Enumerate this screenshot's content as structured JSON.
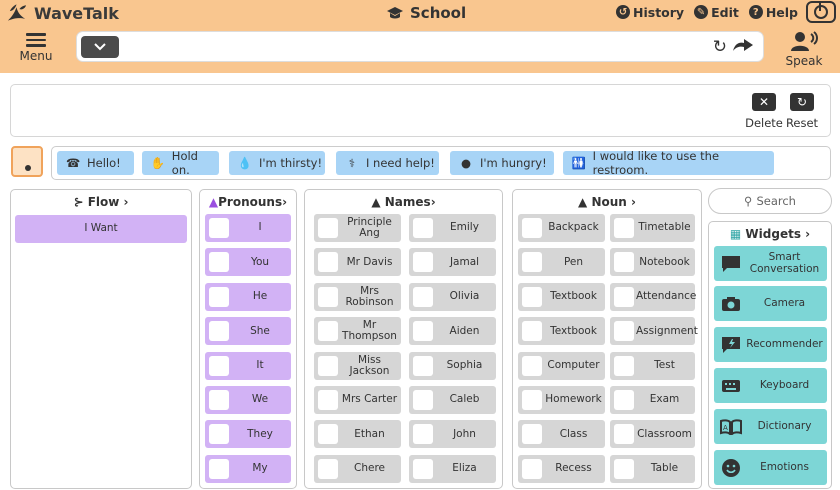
{
  "app": {
    "name": "WaveTalk",
    "title": "School"
  },
  "toplinks": [
    {
      "label": "History",
      "icon": "history-icon"
    },
    {
      "label": "Edit",
      "icon": "edit-icon"
    },
    {
      "label": "Help",
      "icon": "help-icon"
    }
  ],
  "toolbar": {
    "menu_label": "Menu",
    "speak_label": "Speak",
    "input_value": ""
  },
  "message": {
    "delete_label": "Delete",
    "reset_label": "Reset",
    "text": ""
  },
  "phrases": [
    "Hello!",
    "Hold on.",
    "I'm thirsty!",
    "I need help!",
    "I'm hungry!",
    "I would like to use the restroom."
  ],
  "flow": {
    "header": "Flow",
    "items": [
      "I Want"
    ]
  },
  "pronouns": {
    "header": "Pronouns",
    "items": [
      "I",
      "You",
      "He",
      "She",
      "It",
      "We",
      "They",
      "My"
    ]
  },
  "names": {
    "header": "Names",
    "left": [
      "Principle Ang",
      "Mr Davis",
      "Mrs Robinson",
      "Mr Thompson",
      "Miss Jackson",
      "Mrs Carter",
      "Ethan",
      "Chere"
    ],
    "right": [
      "Emily",
      "Jamal",
      "Olivia",
      "Aiden",
      "Sophia",
      "Caleb",
      "John",
      "Eliza"
    ]
  },
  "nouns": {
    "header": "Noun",
    "left": [
      "Backpack",
      "Pen",
      "Textbook",
      "Textbook",
      "Computer",
      "Homework",
      "Class",
      "Recess"
    ],
    "right": [
      "Timetable",
      "Notebook",
      "Attendance",
      "Assignment",
      "Test",
      "Exam",
      "Classroom",
      "Table"
    ]
  },
  "search": {
    "placeholder": "Search"
  },
  "widgets": {
    "header": "Widgets",
    "items": [
      "Smart Conversation",
      "Camera",
      "Recommender",
      "Keyboard",
      "Dictionary",
      "Emotions"
    ]
  },
  "colors": {
    "topbar": "#f9c68f",
    "purple": "#d2b2f5",
    "grey": "#d6d6d6",
    "teal": "#7dd6d6",
    "phrase": "#a8d4f6"
  }
}
